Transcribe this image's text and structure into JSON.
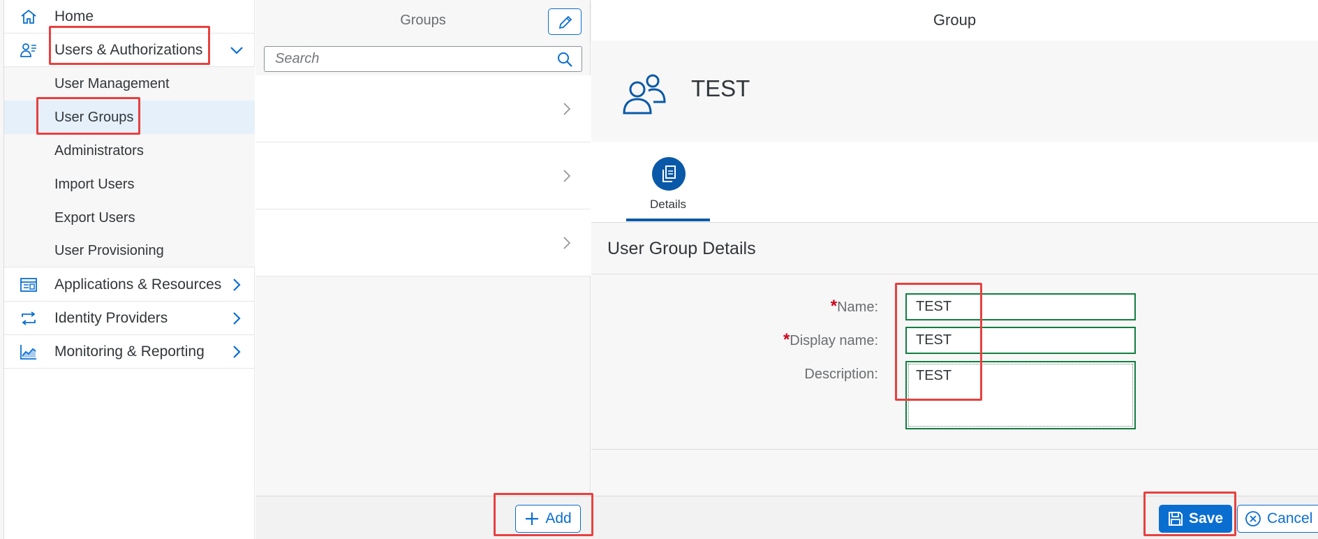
{
  "sidebar": {
    "items": [
      {
        "label": "Home",
        "icon": "home-icon"
      },
      {
        "label": "Users & Authorizations",
        "icon": "user-settings-icon",
        "expanded": true
      },
      {
        "label": "Applications & Resources",
        "icon": "window-icon"
      },
      {
        "label": "Identity Providers",
        "icon": "sync-icon"
      },
      {
        "label": "Monitoring & Reporting",
        "icon": "area-chart-icon"
      }
    ],
    "subitems": [
      {
        "label": "User Management"
      },
      {
        "label": "User Groups",
        "selected": true
      },
      {
        "label": "Administrators"
      },
      {
        "label": "Import Users"
      },
      {
        "label": "Export Users"
      },
      {
        "label": "User Provisioning"
      }
    ]
  },
  "groups": {
    "title": "Groups",
    "search_placeholder": "Search",
    "add_label": "Add"
  },
  "detail": {
    "title": "Group",
    "object_title": "TEST",
    "tab_label": "Details",
    "section_title": "User Group Details",
    "fields": {
      "name_label": "Name:",
      "name_value": "TEST",
      "display_name_label": "Display name:",
      "display_name_value": "TEST",
      "description_label": "Description:",
      "description_value": "TEST"
    },
    "save_label": "Save",
    "cancel_label": "Cancel"
  },
  "colors": {
    "accent": "#0a6ed1",
    "highlight": "#e8403f",
    "valid_border": "#107e3e",
    "required": "#d0021b"
  }
}
